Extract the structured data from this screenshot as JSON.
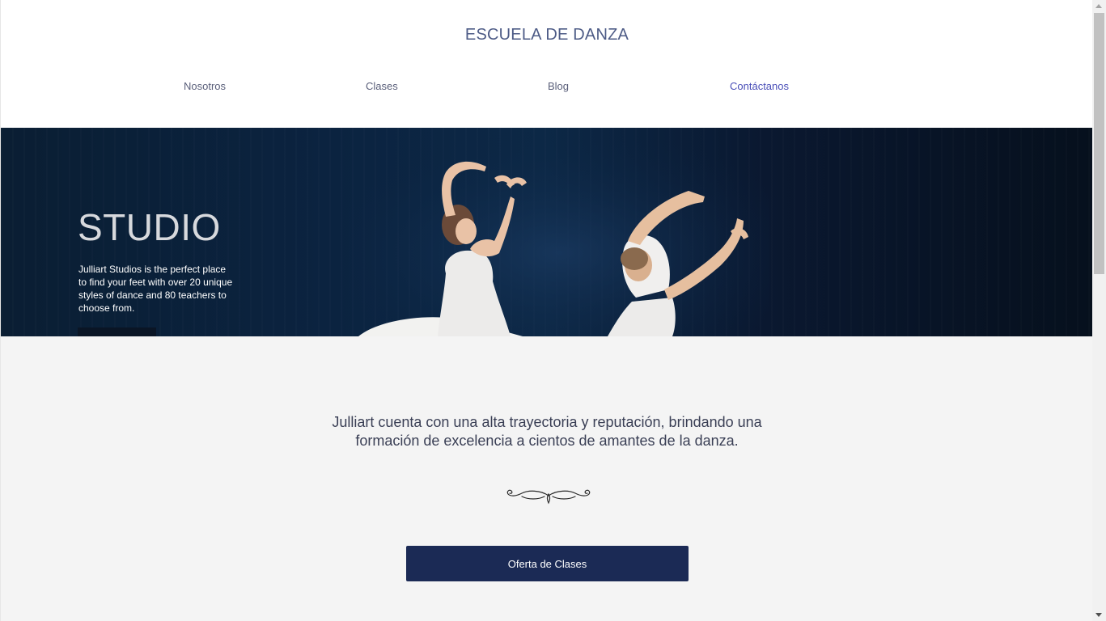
{
  "header": {
    "site_title": "ESCUELA DE DANZA",
    "nav": [
      {
        "label": "Nosotros"
      },
      {
        "label": "Clases"
      },
      {
        "label": "Blog"
      },
      {
        "label": "Contáctanos"
      }
    ]
  },
  "hero": {
    "title": "STUDIO",
    "description": "Julliart Studios is the perfect place to find your feet with over 20 unique styles of dance and 80 teachers to choose from.",
    "image": "dancers-photo"
  },
  "intro": {
    "line1": "Julliart cuenta con una alta trayectoria y reputación, brindando una",
    "line2": "formación de excelencia a cientos de amantes de la danza."
  },
  "ornament_icon": "flourish-divider-icon",
  "cta": {
    "label": "Oferta de Clases"
  },
  "colors": {
    "title": "#4d5b86",
    "nav_active": "#4a4fb8",
    "button": "#1b2a55",
    "hero_bg": "#0b2340"
  }
}
